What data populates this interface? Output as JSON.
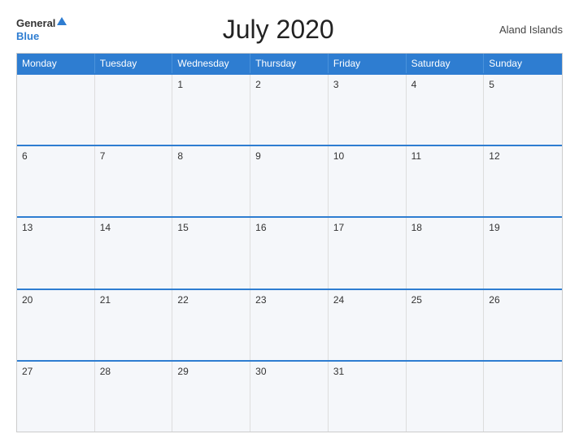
{
  "header": {
    "logo_general": "General",
    "logo_blue": "Blue",
    "title": "July 2020",
    "region": "Aland Islands"
  },
  "calendar": {
    "day_headers": [
      "Monday",
      "Tuesday",
      "Wednesday",
      "Thursday",
      "Friday",
      "Saturday",
      "Sunday"
    ],
    "weeks": [
      [
        {
          "day": "",
          "empty": true
        },
        {
          "day": "",
          "empty": true
        },
        {
          "day": "1"
        },
        {
          "day": "2"
        },
        {
          "day": "3"
        },
        {
          "day": "4"
        },
        {
          "day": "5"
        }
      ],
      [
        {
          "day": "6"
        },
        {
          "day": "7"
        },
        {
          "day": "8"
        },
        {
          "day": "9"
        },
        {
          "day": "10"
        },
        {
          "day": "11"
        },
        {
          "day": "12"
        }
      ],
      [
        {
          "day": "13"
        },
        {
          "day": "14"
        },
        {
          "day": "15"
        },
        {
          "day": "16"
        },
        {
          "day": "17"
        },
        {
          "day": "18"
        },
        {
          "day": "19"
        }
      ],
      [
        {
          "day": "20"
        },
        {
          "day": "21"
        },
        {
          "day": "22"
        },
        {
          "day": "23"
        },
        {
          "day": "24"
        },
        {
          "day": "25"
        },
        {
          "day": "26"
        }
      ],
      [
        {
          "day": "27"
        },
        {
          "day": "28"
        },
        {
          "day": "29"
        },
        {
          "day": "30"
        },
        {
          "day": "31"
        },
        {
          "day": "",
          "empty": true
        },
        {
          "day": "",
          "empty": true
        }
      ]
    ]
  }
}
